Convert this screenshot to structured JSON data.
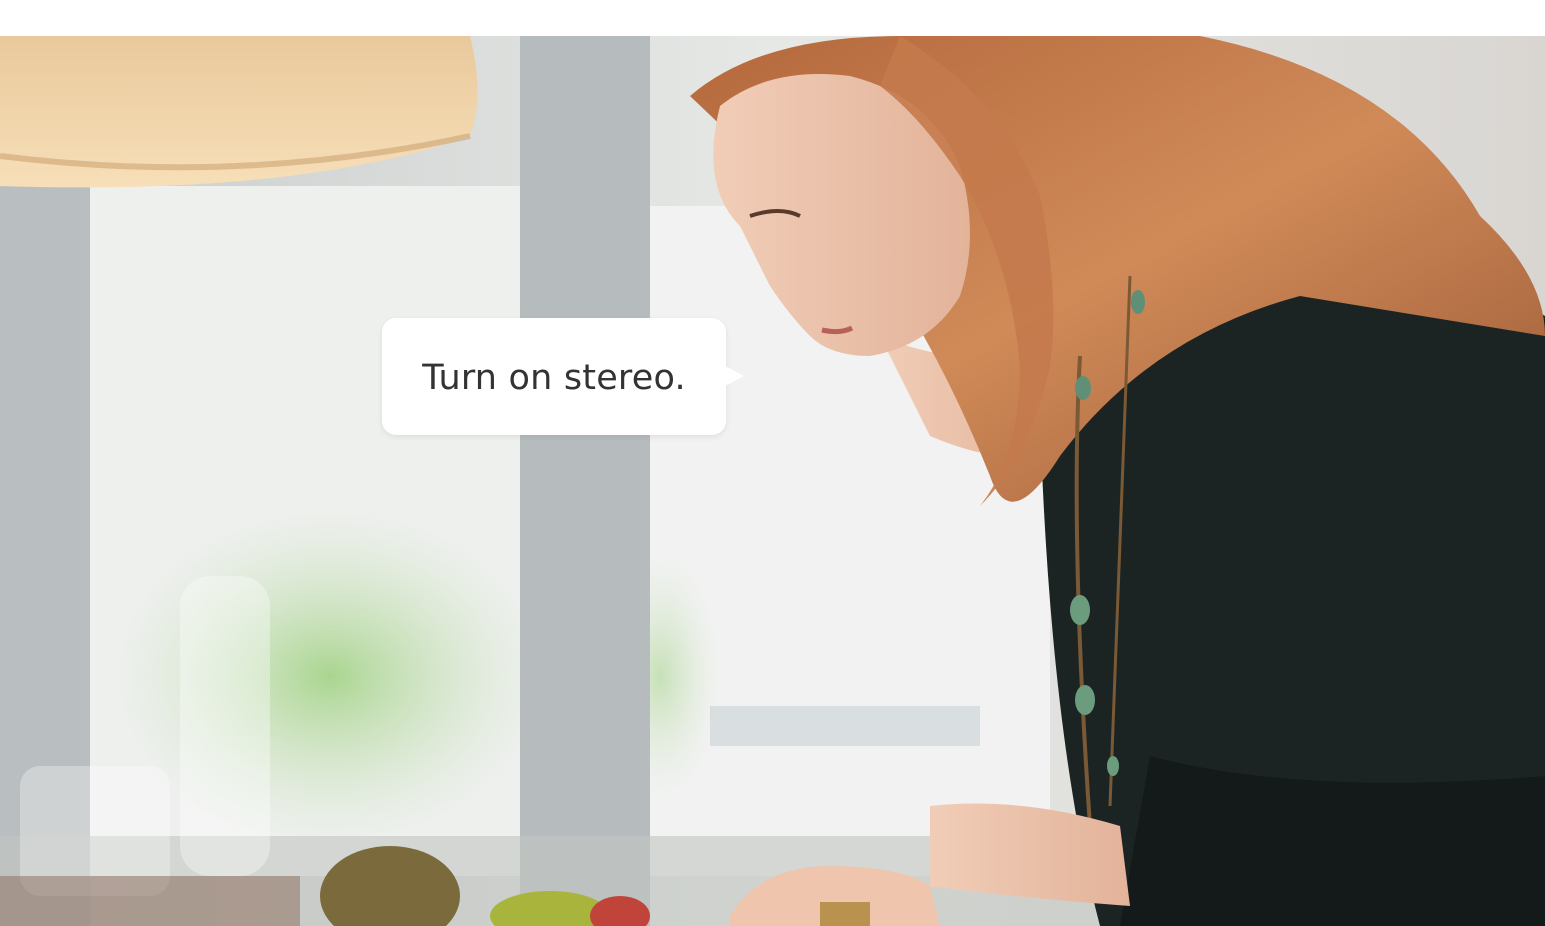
{
  "bubble": {
    "text": "Turn on stereo."
  },
  "photo": {
    "subject": "woman-cooking-photo"
  },
  "colors": {
    "page_background": "#ffffff",
    "bubble_background": "#ffffff",
    "bubble_text": "#333333"
  }
}
